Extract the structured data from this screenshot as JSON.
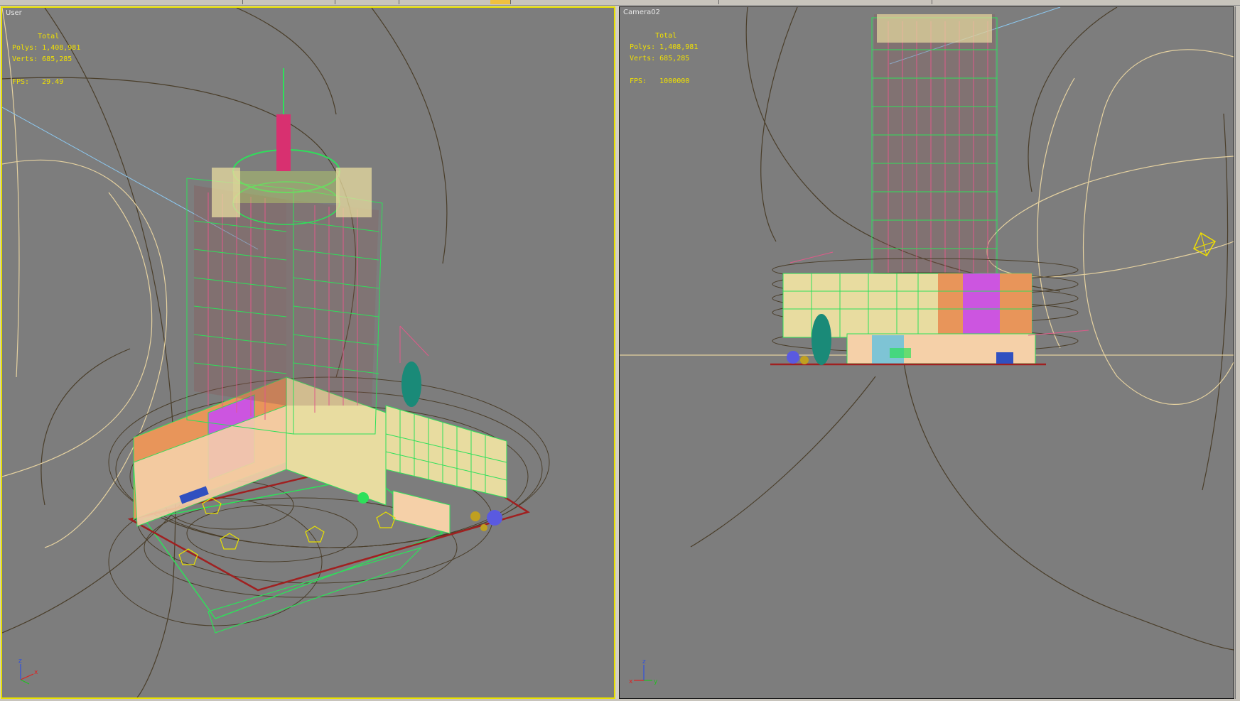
{
  "viewports": {
    "left": {
      "label": "User",
      "stats": {
        "total_label": "Total",
        "polys_label": "Polys:",
        "polys": "1,408,981",
        "verts_label": "Verts:",
        "verts": "685,285",
        "fps_label": "FPS:",
        "fps": "29.49"
      },
      "active": true
    },
    "right": {
      "label": "Camera02",
      "stats": {
        "total_label": "Total",
        "polys_label": "Polys:",
        "polys": "1,408,981",
        "verts_label": "Verts:",
        "verts": "685,285",
        "fps_label": "FPS:",
        "fps": "1000000"
      },
      "active": false
    }
  },
  "axes": {
    "x": "x",
    "y": "y",
    "z": "z"
  },
  "colors": {
    "active_border": "#e8e000",
    "viewport_bg": "#7d7d7d",
    "stats_text": "#f0e000",
    "wire_green": "#2ee05a",
    "wire_pink": "#e05a8a",
    "wire_brown": "#4a3e2a",
    "wire_tan": "#e6d2a0",
    "orange": "#e8955a",
    "magenta": "#cc55e0",
    "cream": "#e8dca0",
    "peach": "#f5d0a8",
    "teal": "#1a8a78"
  }
}
